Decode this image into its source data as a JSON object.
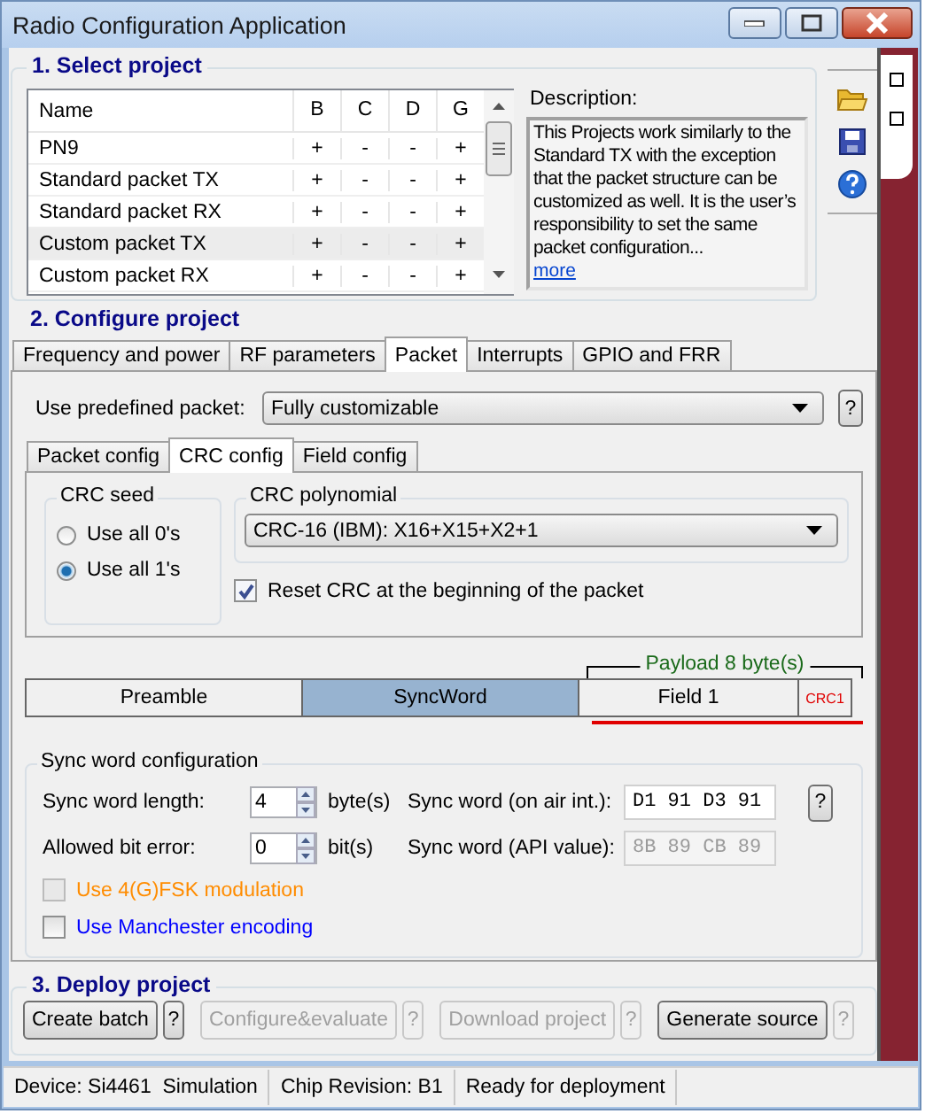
{
  "window": {
    "title": "Radio Configuration Application"
  },
  "select_project": {
    "title": "1. Select project",
    "table": {
      "columns": [
        "Name",
        "B",
        "C",
        "D",
        "G"
      ],
      "rows": [
        {
          "cells": [
            "PN9",
            "+",
            "-",
            "-",
            "+"
          ],
          "selected": false
        },
        {
          "cells": [
            "Standard packet TX",
            "+",
            "-",
            "-",
            "+"
          ],
          "selected": false
        },
        {
          "cells": [
            "Standard packet RX",
            "+",
            "-",
            "-",
            "+"
          ],
          "selected": false
        },
        {
          "cells": [
            "Custom packet TX",
            "+",
            "-",
            "-",
            "+"
          ],
          "selected": true
        },
        {
          "cells": [
            "Custom packet RX",
            "+",
            "-",
            "-",
            "+"
          ],
          "selected": false
        }
      ]
    },
    "description": {
      "label": "Description:",
      "text": "This Projects work similarly to the Standard TX with the exception that the packet structure can be customized as well. It is the user’s responsibility to set the same packet configuration...",
      "link": "more"
    }
  },
  "configure_project": {
    "title": "2. Configure project",
    "tabs": [
      {
        "label": "Frequency and power",
        "selected": false
      },
      {
        "label": "RF parameters",
        "selected": false
      },
      {
        "label": "Packet",
        "selected": true
      },
      {
        "label": "Interrupts",
        "selected": false
      },
      {
        "label": "GPIO and FRR",
        "selected": false
      }
    ],
    "predefined_packet": {
      "label": "Use predefined packet:",
      "value": "Fully customizable",
      "help": "?"
    },
    "subtabs": [
      {
        "label": "Packet config",
        "selected": false
      },
      {
        "label": "CRC config",
        "selected": true
      },
      {
        "label": "Field config",
        "selected": false
      }
    ],
    "crc_seed": {
      "title": "CRC seed",
      "options": [
        {
          "label": "Use all 0's",
          "selected": false
        },
        {
          "label": "Use all 1's",
          "selected": true
        }
      ]
    },
    "crc_polynomial": {
      "title": "CRC polynomial",
      "value": "CRC-16 (IBM): X16+X15+X2+1"
    },
    "reset_crc": {
      "label": "Reset CRC at the beginning of the packet",
      "checked": true
    },
    "packet_diagram": {
      "payload_label": "Payload 8 byte(s)",
      "segments": [
        {
          "label": "Preamble",
          "kind": "field",
          "selected": false
        },
        {
          "label": "SyncWord",
          "kind": "field",
          "selected": true
        },
        {
          "label": "Field 1",
          "kind": "field",
          "selected": false
        },
        {
          "label": "CRC1",
          "kind": "crc",
          "selected": false
        }
      ]
    },
    "sync_word": {
      "title": "Sync word configuration",
      "length": {
        "label": "Sync word length:",
        "value": "4",
        "unit": "byte(s)"
      },
      "bit_error": {
        "label": "Allowed bit error:",
        "value": "0",
        "unit": "bit(s)"
      },
      "on_air": {
        "label": "Sync word (on air int.):",
        "value": "D1 91 D3 91",
        "disabled": false
      },
      "api": {
        "label": "Sync word (API value):",
        "value": "8B 89 CB 89",
        "disabled": true
      },
      "help": "?",
      "options": [
        {
          "label": "Use 4(G)FSK modulation",
          "checked": false,
          "disabled": true,
          "color": "#ff8c00"
        },
        {
          "label": "Use Manchester encoding",
          "checked": false,
          "disabled": false,
          "color": "#0000ff"
        }
      ]
    }
  },
  "deploy_project": {
    "title": "3. Deploy project",
    "buttons": [
      {
        "label": "Create batch",
        "disabled": false,
        "help": "?",
        "help_disabled": false
      },
      {
        "label": "Configure&evaluate",
        "disabled": true,
        "help": "?",
        "help_disabled": true
      },
      {
        "label": "Download project",
        "disabled": true,
        "help": "?",
        "help_disabled": true
      },
      {
        "label": "Generate source",
        "disabled": false,
        "help": "?",
        "help_disabled": true
      }
    ]
  },
  "status_bar": [
    "Device: Si4461  Simulation",
    "Chip Revision: B1",
    "Ready for deployment"
  ]
}
